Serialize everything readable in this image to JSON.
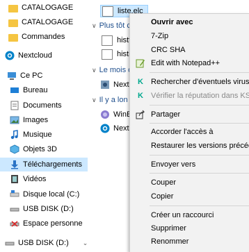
{
  "sidebar": {
    "items": [
      {
        "label": "CATALOGAGE",
        "icon": "folder-icon"
      },
      {
        "label": "CATALOGAGE",
        "icon": "folder-icon"
      },
      {
        "label": "Commandes",
        "icon": "folder-icon"
      },
      {
        "label": "Nextcloud",
        "icon": "nextcloud-icon"
      },
      {
        "label": "Ce PC",
        "icon": "computer-icon"
      },
      {
        "label": "Bureau",
        "icon": "desktop-icon"
      },
      {
        "label": "Documents",
        "icon": "documents-icon"
      },
      {
        "label": "Images",
        "icon": "images-icon"
      },
      {
        "label": "Musique",
        "icon": "music-icon"
      },
      {
        "label": "Objets 3D",
        "icon": "objects3d-icon"
      },
      {
        "label": "Téléchargements",
        "icon": "downloads-icon"
      },
      {
        "label": "Vidéos",
        "icon": "videos-icon"
      },
      {
        "label": "Disque local (C:)",
        "icon": "local-disk-icon"
      },
      {
        "label": "USB DISK (D:)",
        "icon": "usb-disk-icon"
      },
      {
        "label": "Espace personne",
        "icon": "network-drive-icon"
      },
      {
        "label": "USB DISK (D:)",
        "icon": "usb-disk-icon"
      }
    ]
  },
  "files": {
    "selected": "liste.elc",
    "groups": [
      {
        "label": "Plus tôt c",
        "items": [
          "histfc",
          "histre"
        ]
      },
      {
        "label": "Le mois c",
        "items": [
          "Nexto"
        ]
      },
      {
        "label": "Il y a lon",
        "items": [
          "WinE",
          "Nexto"
        ]
      }
    ]
  },
  "context_menu": {
    "open_with": "Ouvrir avec",
    "zip": "7-Zip",
    "crc": "CRC SHA",
    "notepad": "Edit with Notepad++",
    "scan": "Rechercher d'éventuels virus",
    "reputation": "Vérifier la réputation dans KSN",
    "share": "Partager",
    "grant_access": "Accorder l'accès à",
    "restore": "Restaurer les versions précédentes",
    "send_to": "Envoyer vers",
    "cut": "Couper",
    "copy": "Copier",
    "shortcut": "Créer un raccourci",
    "delete": "Supprimer",
    "rename": "Renommer"
  }
}
